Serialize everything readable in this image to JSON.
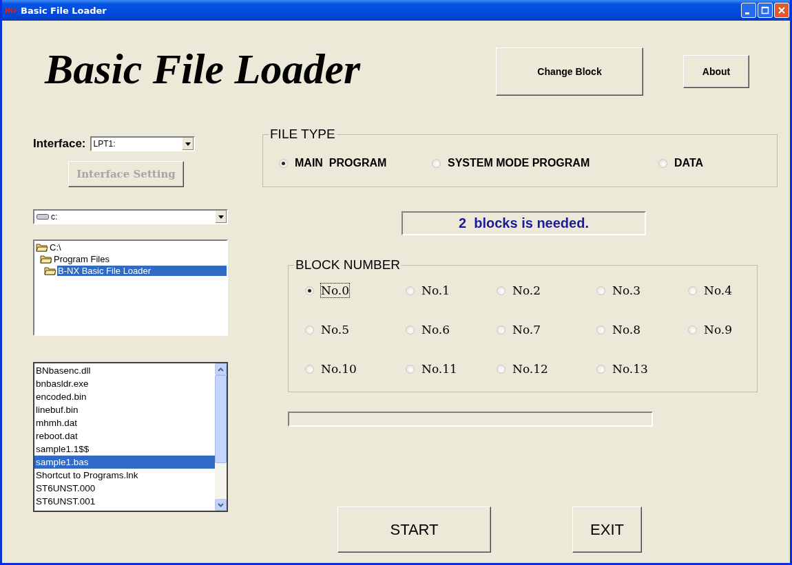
{
  "window": {
    "title": "Basic File Loader"
  },
  "heading": "Basic File Loader",
  "top_buttons": [
    {
      "label": "Change Block"
    },
    {
      "label": "About"
    }
  ],
  "interface": {
    "label": "Interface:",
    "value": "LPT1:",
    "button": {
      "label": "Interface Setting",
      "disabled": true
    }
  },
  "drive": {
    "value": "c:"
  },
  "folders": [
    {
      "name": "C:\\",
      "selected": false,
      "children": [
        {
          "name": "Program Files",
          "selected": false,
          "children": [
            {
              "name": "B-NX Basic File Loader",
              "selected": true
            }
          ]
        }
      ]
    }
  ],
  "files": [
    {
      "name": "BNbasenc.dll",
      "selected": false
    },
    {
      "name": "bnbasldr.exe",
      "selected": false
    },
    {
      "name": "encoded.bin",
      "selected": false
    },
    {
      "name": "linebuf.bin",
      "selected": false
    },
    {
      "name": "mhmh.dat",
      "selected": false
    },
    {
      "name": "reboot.dat",
      "selected": false
    },
    {
      "name": "sample1.1$$",
      "selected": false
    },
    {
      "name": "sample1.bas",
      "selected": true
    },
    {
      "name": "Shortcut to Programs.lnk",
      "selected": false
    },
    {
      "name": "ST6UNST.000",
      "selected": false
    },
    {
      "name": "ST6UNST.001",
      "selected": false
    }
  ],
  "file_type": {
    "title": "FILE TYPE",
    "options": [
      {
        "label": "MAIN  PROGRAM",
        "selected": true
      },
      {
        "label": "SYSTEM MODE PROGRAM",
        "selected": false
      },
      {
        "label": "DATA",
        "selected": false
      }
    ]
  },
  "status": "2  blocks is needed.",
  "block_number": {
    "title": "BLOCK NUMBER",
    "options": [
      {
        "label": "No.0",
        "selected": true
      },
      {
        "label": "No.1",
        "selected": false
      },
      {
        "label": "No.2",
        "selected": false
      },
      {
        "label": "No.3",
        "selected": false
      },
      {
        "label": "No.4",
        "selected": false
      },
      {
        "label": "No.5",
        "selected": false
      },
      {
        "label": "No.6",
        "selected": false
      },
      {
        "label": "No.7",
        "selected": false
      },
      {
        "label": "No.8",
        "selected": false
      },
      {
        "label": "No.9",
        "selected": false
      },
      {
        "label": "No.10",
        "selected": false
      },
      {
        "label": "No.11",
        "selected": false
      },
      {
        "label": "No.12",
        "selected": false
      },
      {
        "label": "No.13",
        "selected": false
      }
    ]
  },
  "progress": {
    "level": 0
  },
  "buttons": [
    {
      "label": "START"
    },
    {
      "label": "EXIT"
    }
  ]
}
